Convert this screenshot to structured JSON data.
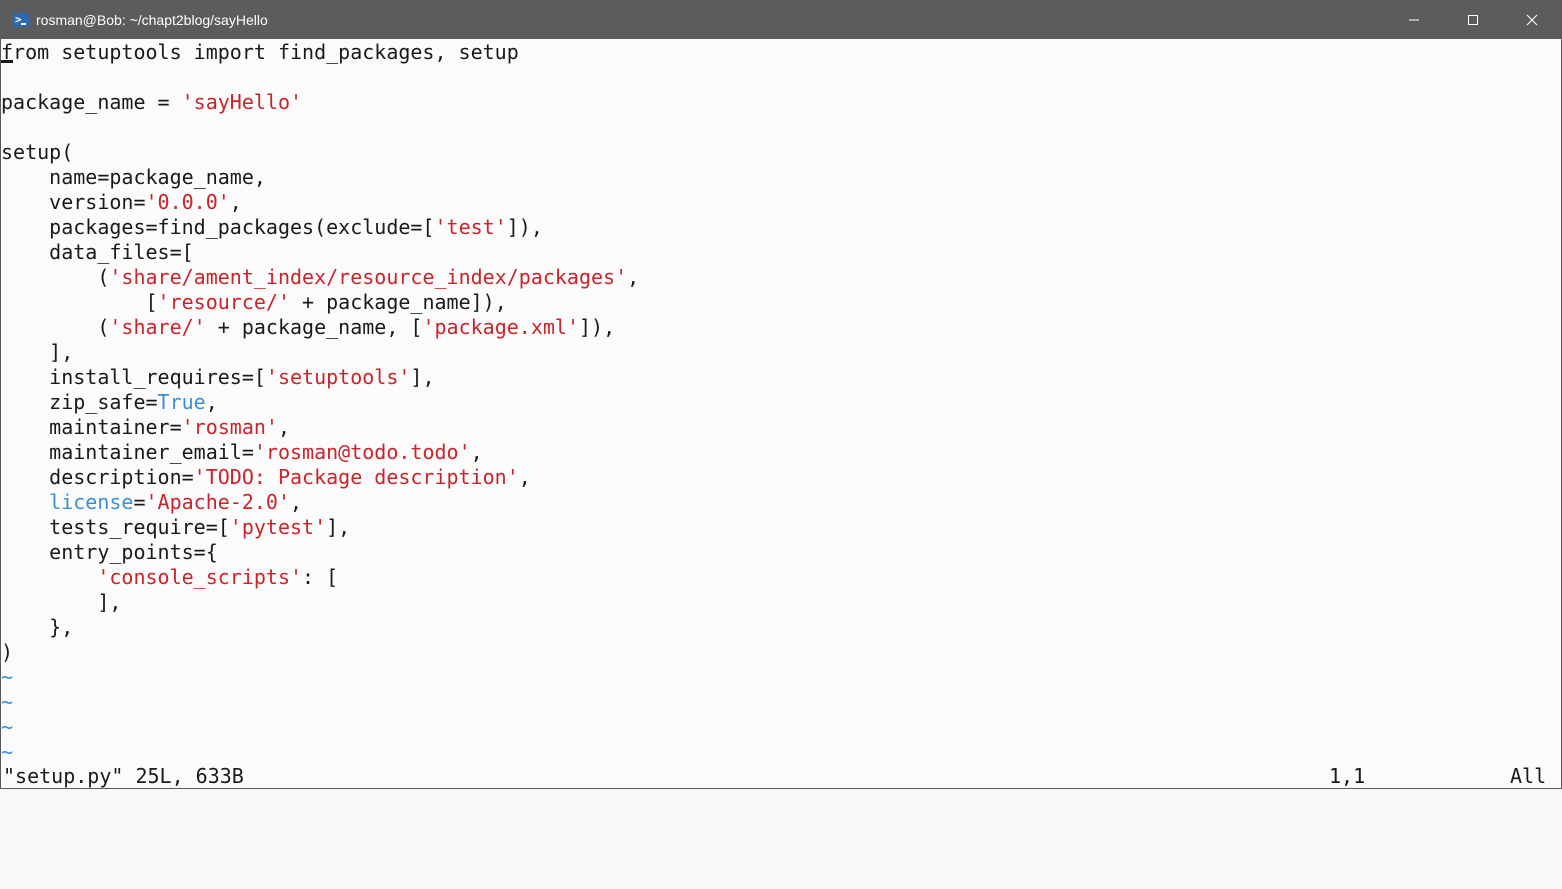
{
  "window": {
    "title": "rosman@Bob: ~/chapt2blog/sayHello",
    "app_icon": "powershell-terminal-icon",
    "controls": [
      "minimize-icon",
      "maximize-icon",
      "close-icon"
    ]
  },
  "editor": {
    "lines": [
      [
        {
          "t": "from setuptools import find_packages, setup",
          "c": "kw"
        }
      ],
      [
        {
          "t": "",
          "c": "kw"
        }
      ],
      [
        {
          "t": "package_name = ",
          "c": "kw"
        },
        {
          "t": "'sayHello'",
          "c": "str"
        }
      ],
      [
        {
          "t": "",
          "c": "kw"
        }
      ],
      [
        {
          "t": "setup(",
          "c": "kw"
        }
      ],
      [
        {
          "t": "    name=package_name,",
          "c": "kw"
        }
      ],
      [
        {
          "t": "    version=",
          "c": "kw"
        },
        {
          "t": "'0.0.0'",
          "c": "str"
        },
        {
          "t": ",",
          "c": "kw"
        }
      ],
      [
        {
          "t": "    packages=find_packages(exclude=[",
          "c": "kw"
        },
        {
          "t": "'test'",
          "c": "str"
        },
        {
          "t": "]),",
          "c": "kw"
        }
      ],
      [
        {
          "t": "    data_files=[",
          "c": "kw"
        }
      ],
      [
        {
          "t": "        (",
          "c": "kw"
        },
        {
          "t": "'share/ament_index/resource_index/packages'",
          "c": "str"
        },
        {
          "t": ",",
          "c": "kw"
        }
      ],
      [
        {
          "t": "            [",
          "c": "kw"
        },
        {
          "t": "'resource/'",
          "c": "str"
        },
        {
          "t": " + package_name]),",
          "c": "kw"
        }
      ],
      [
        {
          "t": "        (",
          "c": "kw"
        },
        {
          "t": "'share/'",
          "c": "str"
        },
        {
          "t": " + package_name, [",
          "c": "kw"
        },
        {
          "t": "'package.xml'",
          "c": "str"
        },
        {
          "t": "]),",
          "c": "kw"
        }
      ],
      [
        {
          "t": "    ],",
          "c": "kw"
        }
      ],
      [
        {
          "t": "    install_requires=[",
          "c": "kw"
        },
        {
          "t": "'setuptools'",
          "c": "str"
        },
        {
          "t": "],",
          "c": "kw"
        }
      ],
      [
        {
          "t": "    zip_safe=",
          "c": "kw"
        },
        {
          "t": "True",
          "c": "bool"
        },
        {
          "t": ",",
          "c": "kw"
        }
      ],
      [
        {
          "t": "    maintainer=",
          "c": "kw"
        },
        {
          "t": "'rosman'",
          "c": "str"
        },
        {
          "t": ",",
          "c": "kw"
        }
      ],
      [
        {
          "t": "    maintainer_email=",
          "c": "kw"
        },
        {
          "t": "'rosman@todo.todo'",
          "c": "str"
        },
        {
          "t": ",",
          "c": "kw"
        }
      ],
      [
        {
          "t": "    description=",
          "c": "kw"
        },
        {
          "t": "'TODO: Package description'",
          "c": "str"
        },
        {
          "t": ",",
          "c": "kw"
        }
      ],
      [
        {
          "t": "    ",
          "c": "kw"
        },
        {
          "t": "license",
          "c": "lic"
        },
        {
          "t": "=",
          "c": "kw"
        },
        {
          "t": "'Apache-2.0'",
          "c": "str"
        },
        {
          "t": ",",
          "c": "kw"
        }
      ],
      [
        {
          "t": "    tests_require=[",
          "c": "kw"
        },
        {
          "t": "'pytest'",
          "c": "str"
        },
        {
          "t": "],",
          "c": "kw"
        }
      ],
      [
        {
          "t": "    entry_points={",
          "c": "kw"
        }
      ],
      [
        {
          "t": "        ",
          "c": "kw"
        },
        {
          "t": "'console_scripts'",
          "c": "str"
        },
        {
          "t": ": [",
          "c": "kw"
        }
      ],
      [
        {
          "t": "        ],",
          "c": "kw"
        }
      ],
      [
        {
          "t": "    },",
          "c": "kw"
        }
      ],
      [
        {
          "t": ")",
          "c": "kw"
        }
      ]
    ],
    "tilde_lines": [
      "~",
      "~",
      "~",
      "~"
    ],
    "colors": {
      "keyword_text": "#1a1a1a",
      "string": "#c8242b",
      "boolean": "#3c8fd6",
      "builtin": "#3c8fd6",
      "tilde": "#3c8fd6"
    }
  },
  "statusline": {
    "file_info": "\"setup.py\" 25L, 633B",
    "position": "1,1",
    "scroll": "All"
  }
}
